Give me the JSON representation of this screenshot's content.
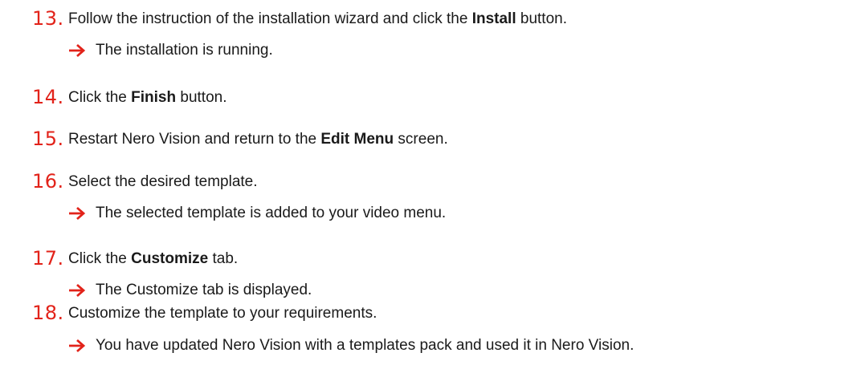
{
  "colors": {
    "step_number": "#e2231a",
    "arrow": "#e2231a",
    "text": "#1a1a1a"
  },
  "icons": {
    "result": "right-arrow-icon"
  },
  "steps": [
    {
      "number": "13.",
      "before": "Follow the instruction of the installation wizard and click the ",
      "bold": "Install",
      "after": " button.",
      "result": "The installation is running."
    },
    {
      "number": "14.",
      "before": "Click the ",
      "bold": "Finish",
      "after": " button."
    },
    {
      "number": "15.",
      "before": "Restart Nero Vision and return to the ",
      "bold": "Edit Menu",
      "after": " screen."
    },
    {
      "number": "16.",
      "before": "Select the desired template.",
      "result": "The selected template is added to your video menu."
    },
    {
      "number": "17.",
      "before": "Click the ",
      "bold": "Customize",
      "after": " tab.",
      "result": "The Customize tab is displayed."
    },
    {
      "number": "18.",
      "before": "Customize the template to your requirements.",
      "result": "You have updated Nero Vision with a templates pack and used it in Nero Vision."
    }
  ]
}
